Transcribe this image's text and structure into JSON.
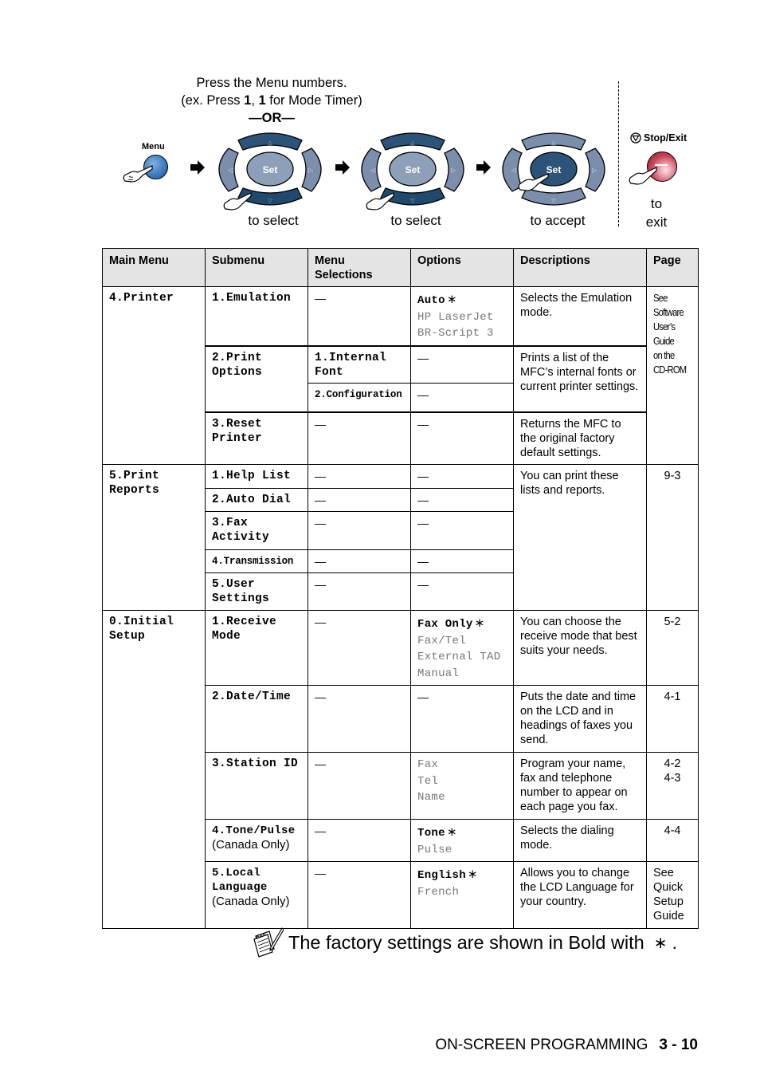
{
  "instructions": {
    "line1": "Press the Menu numbers.",
    "line2_prefix": "(ex. Press ",
    "line2_key1": "1",
    "line2_sep": ", ",
    "line2_key2": "1",
    "line2_suffix": " for Mode Timer)",
    "or": "—OR—",
    "menu_button_label": "Menu",
    "set_label": "Set",
    "steps": [
      {
        "caption": "to select",
        "pressed": "down"
      },
      {
        "caption": "to select",
        "pressed": "down"
      },
      {
        "caption": "to accept",
        "pressed": "set"
      }
    ],
    "stop_exit_label": "Stop/Exit",
    "exit_caption_line1": "to",
    "exit_caption_line2": "exit"
  },
  "table": {
    "headers": [
      "Main Menu",
      "Submenu",
      "Menu\nSelections",
      "Options",
      "Descriptions",
      "Page"
    ],
    "dash": "—",
    "printer": {
      "main": "4.Printer",
      "emulation": {
        "submenu": "1.Emulation",
        "options": [
          "Auto",
          "HP LaserJet",
          "BR-Script 3"
        ],
        "default_option": "Auto",
        "description": "Selects the Emulation mode."
      },
      "print_options": {
        "submenu_line1": "2.Print",
        "submenu_line2": "Options",
        "selections": [
          {
            "line1": "1.Internal",
            "line2": "Font"
          },
          {
            "line1": "2.Configuration"
          }
        ],
        "description": "Prints a list of the MFC’s internal fonts or current printer settings."
      },
      "reset": {
        "submenu_line1": "3.Reset",
        "submenu_line2": "Printer",
        "description": "Returns the MFC to the original factory default settings."
      },
      "page_lines": [
        "See",
        "Software",
        "User’s",
        "Guide",
        "on the",
        "CD-ROM"
      ]
    },
    "print_reports": {
      "main_line1": "5.Print",
      "main_line2": "Reports",
      "submenus": [
        {
          "line1": "1.Help List"
        },
        {
          "line1": "2.Auto Dial"
        },
        {
          "line1": "3.Fax",
          "line2": "Activity"
        },
        {
          "line1": "4.Transmission"
        },
        {
          "line1": "5.User",
          "line2": "Settings"
        }
      ],
      "description": "You can print these lists and reports.",
      "page": "9-3"
    },
    "initial_setup": {
      "main_line1": "0.Initial",
      "main_line2": "Setup",
      "receive_mode": {
        "submenu_line1": "1.Receive",
        "submenu_line2": "Mode",
        "options": [
          "Fax Only",
          "Fax/Tel",
          "External TAD",
          "Manual"
        ],
        "description": "You can choose the receive mode that best suits your needs.",
        "page": "5-2"
      },
      "date_time": {
        "submenu": "2.Date/Time",
        "description": "Puts the date and time on the LCD and in headings of faxes you send.",
        "page": "4-1"
      },
      "station_id": {
        "submenu": "3.Station ID",
        "options": [
          "Fax",
          "Tel",
          "Name"
        ],
        "description": "Program your name, fax and telephone number to appear on each page you fax.",
        "page_line1": "4-2",
        "page_line2": "4-3"
      },
      "tone_pulse": {
        "submenu": "4.Tone/Pulse",
        "note": "(Canada Only)",
        "options": [
          "Tone",
          "Pulse"
        ],
        "description": "Selects the dialing mode.",
        "page": "4-4"
      },
      "local_language": {
        "submenu_line1": "5.Local",
        "submenu_line2": "Language",
        "note": "(Canada Only)",
        "options": [
          "English",
          "French"
        ],
        "description": "Allows you to change the LCD Language for your country.",
        "page_lines": [
          "See",
          "Quick",
          "Setup",
          "Guide"
        ]
      }
    },
    "default_marker": "∗"
  },
  "note": {
    "text": "The factory settings are shown in Bold with",
    "marker": "∗",
    "end": "."
  },
  "footer": {
    "section": "ON-SCREEN PROGRAMMING",
    "page": "3 - 10"
  },
  "colors": {
    "dpad_dark": "#2b5478",
    "dpad_light": "#7b8fac",
    "menu_button": "#3a78bd",
    "stop_button": "#c9475a",
    "header_bg": "#e4e4e4",
    "non_default_option": "#777777"
  }
}
